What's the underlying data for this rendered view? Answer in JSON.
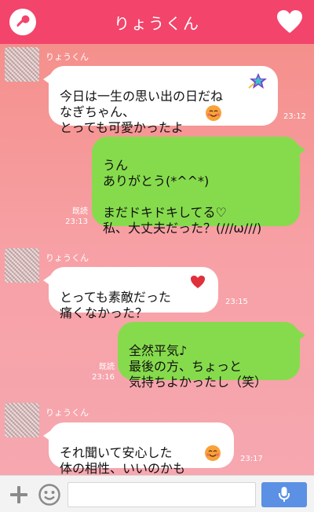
{
  "header": {
    "title": "りょうくん",
    "left_icon": "key-icon",
    "right_icon": "heart-icon",
    "accent": "#f3446b"
  },
  "messages": [
    {
      "side": "in",
      "sender": "りょうくん",
      "text": "今日は一生の思い出の日だね\nなぎちゃん、\nとっても可愛かったよ",
      "time": "23:12"
    },
    {
      "side": "out",
      "text": "うん\nありがとう(*^^*)\n\nまだドキドキしてる♡\n私、大丈夫だった？(///ω///)",
      "read": "既読",
      "time": "23:13"
    },
    {
      "side": "in",
      "sender": "りょうくん",
      "text": "とっても素敵だった\n痛くなかった？",
      "time": "23:15"
    },
    {
      "side": "out",
      "text": "全然平気♪\n最後の方、ちょっと\n気持ちよかったし（笑）",
      "read": "既読",
      "time": "23:16"
    },
    {
      "side": "in",
      "sender": "りょうくん",
      "text": "それ聞いて安心した\n体の相性、いいのかも",
      "time": "23:17"
    }
  ],
  "composer": {
    "input_value": "",
    "plus_icon": "plus-icon",
    "emoji_icon": "smiley-icon",
    "send_icon": "microphone-icon"
  },
  "colors": {
    "bubble_out": "#86db4c",
    "bubble_in": "#ffffff",
    "mic": "#5b90e4"
  }
}
